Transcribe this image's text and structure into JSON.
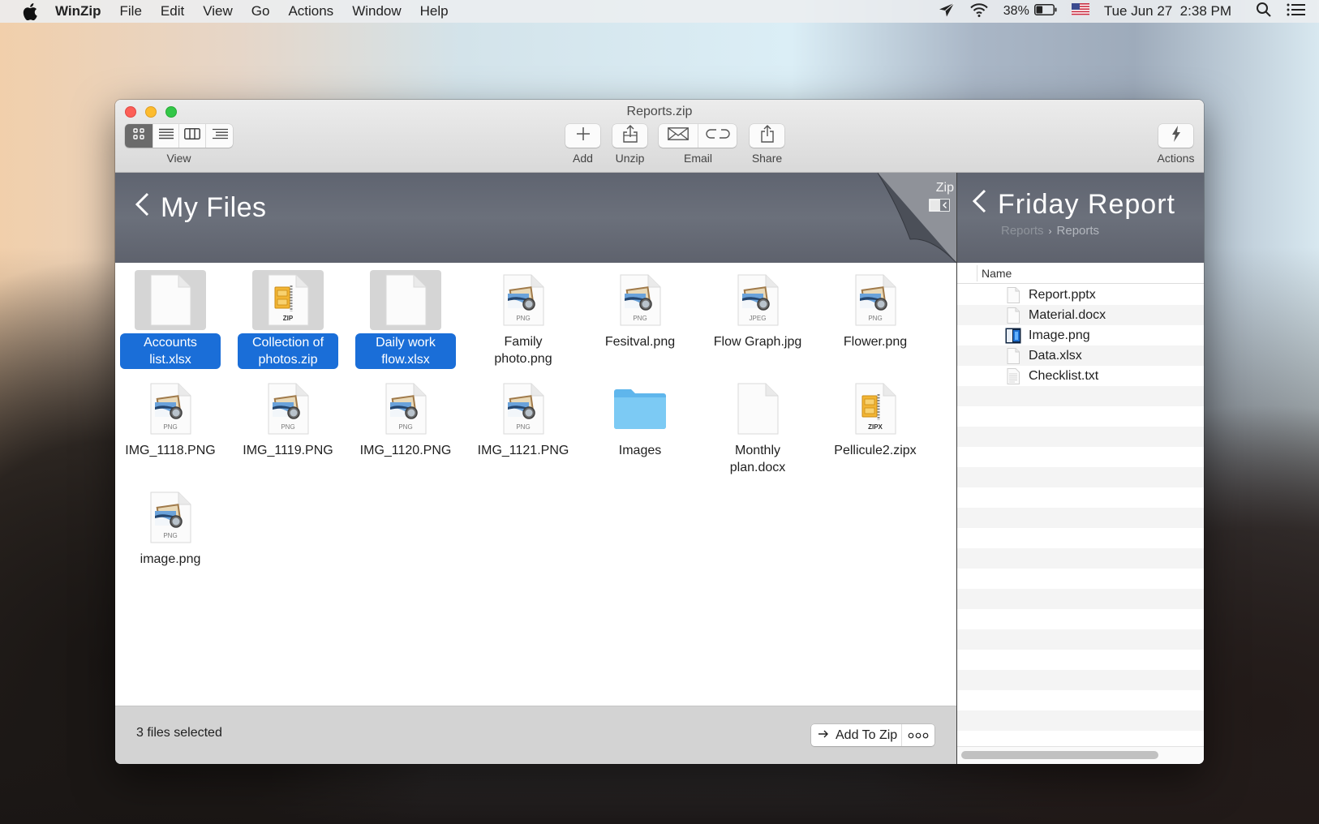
{
  "menubar": {
    "app_name": "WinZip",
    "items": [
      "File",
      "Edit",
      "View",
      "Go",
      "Actions",
      "Window",
      "Help"
    ],
    "battery_percent": "38%",
    "battery_level": 0.38,
    "datetime": "Tue Jun 27  2:38 PM",
    "icons": [
      "apple-logo",
      "location-arrow",
      "wifi",
      "battery",
      "us-flag",
      "spotlight-search",
      "notification-center"
    ]
  },
  "window": {
    "title": "Reports.zip",
    "toolbar": {
      "view_label": "View",
      "view_modes": [
        "icon-view",
        "list-view",
        "column-view",
        "outline-view"
      ],
      "active_view": "icon-view",
      "add_label": "Add",
      "unzip_label": "Unzip",
      "email_label": "Email",
      "share_label": "Share",
      "actions_label": "Actions"
    }
  },
  "left_pane": {
    "title": "My Files",
    "zip_tab_label": "Zip",
    "files": [
      {
        "name": "Accounts list.xlsx",
        "icon": "blank-doc",
        "selected": true
      },
      {
        "name": "Collection of photos.zip",
        "icon": "zip",
        "badge": "ZIP",
        "selected": true
      },
      {
        "name": "Daily work flow.xlsx",
        "icon": "blank-doc",
        "selected": true
      },
      {
        "name": "Family photo.png",
        "icon": "image",
        "badge": "PNG",
        "selected": false
      },
      {
        "name": "Fesitval.png",
        "icon": "image",
        "badge": "PNG",
        "selected": false
      },
      {
        "name": "Flow Graph.jpg",
        "icon": "image",
        "badge": "JPEG",
        "selected": false
      },
      {
        "name": "Flower.png",
        "icon": "image",
        "badge": "PNG",
        "selected": false
      },
      {
        "name": "IMG_1118.PNG",
        "icon": "image",
        "badge": "PNG",
        "selected": false
      },
      {
        "name": "IMG_1119.PNG",
        "icon": "image",
        "badge": "PNG",
        "selected": false
      },
      {
        "name": "IMG_1120.PNG",
        "icon": "image",
        "badge": "PNG",
        "selected": false
      },
      {
        "name": "IMG_1121.PNG",
        "icon": "image",
        "badge": "PNG",
        "selected": false
      },
      {
        "name": "Images",
        "icon": "folder",
        "selected": false
      },
      {
        "name": "Monthly plan.docx",
        "icon": "blank-doc",
        "selected": false
      },
      {
        "name": "Pellicule2.zipx",
        "icon": "zip",
        "badge": "ZIPX",
        "selected": false
      },
      {
        "name": "image.png",
        "icon": "image",
        "badge": "PNG",
        "selected": false
      }
    ],
    "status": "3 files selected",
    "add_to_zip_label": "Add To Zip"
  },
  "right_pane": {
    "title": "Friday Report",
    "breadcrumb": [
      "Reports",
      "Reports"
    ],
    "column_header": "Name",
    "files": [
      {
        "name": "Report.pptx",
        "icon": "blank-doc"
      },
      {
        "name": "Material.docx",
        "icon": "blank-doc"
      },
      {
        "name": "Image.png",
        "icon": "image-thumb"
      },
      {
        "name": "Data.xlsx",
        "icon": "blank-doc"
      },
      {
        "name": "Checklist.txt",
        "icon": "text-doc"
      }
    ]
  }
}
